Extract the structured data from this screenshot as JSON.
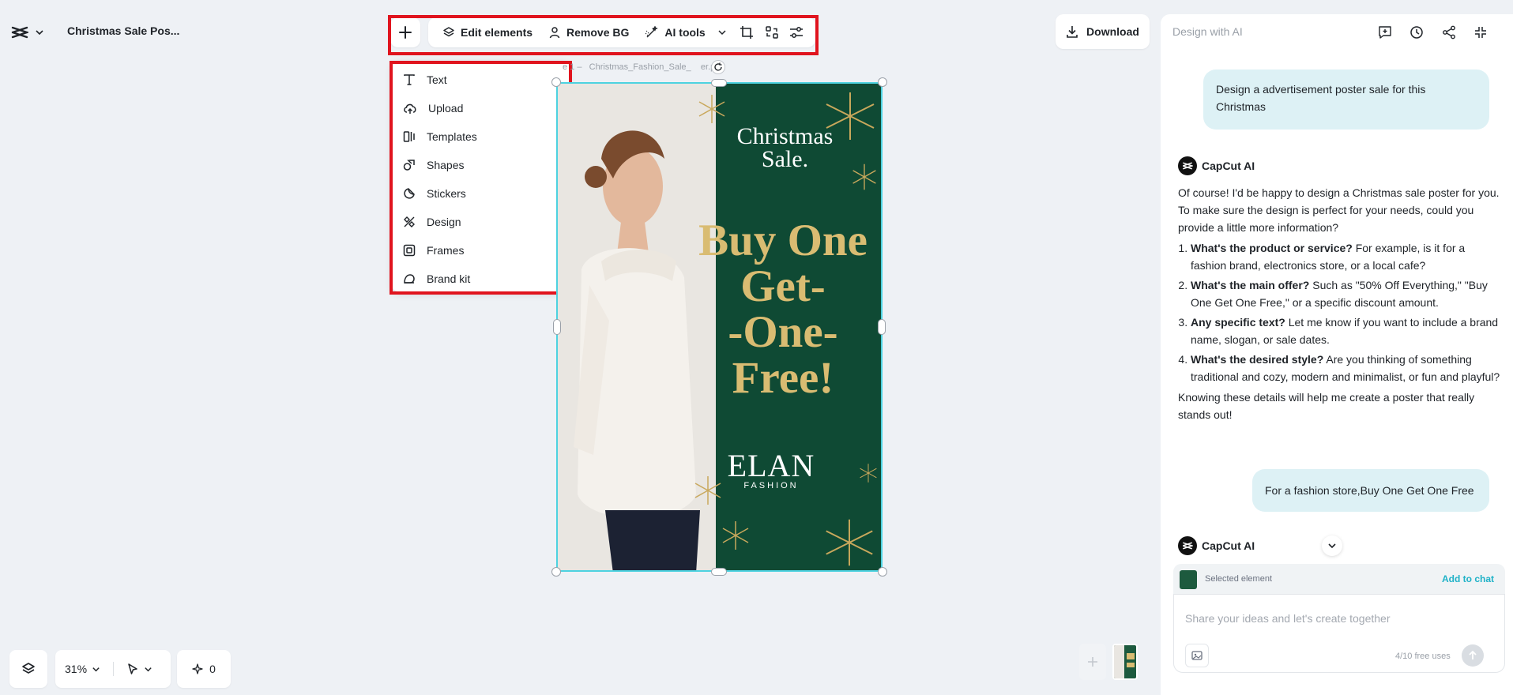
{
  "header": {
    "title": "Christmas Sale Pos..."
  },
  "toolbar": {
    "edit_elements": "Edit elements",
    "remove_bg": "Remove BG",
    "ai_tools": "AI tools"
  },
  "add_menu": {
    "items": [
      {
        "label": "Text",
        "icon": "text-icon"
      },
      {
        "label": "Upload",
        "icon": "cloud-upload-icon"
      },
      {
        "label": "Templates",
        "icon": "templates-icon"
      },
      {
        "label": "Shapes",
        "icon": "shapes-icon"
      },
      {
        "label": "Stickers",
        "icon": "sticker-icon"
      },
      {
        "label": "Design",
        "icon": "design-icon"
      },
      {
        "label": "Frames",
        "icon": "frame-icon"
      },
      {
        "label": "Brand kit",
        "icon": "brand-kit-icon"
      }
    ]
  },
  "canvas": {
    "page_label_a": "e 1 –",
    "page_label_b": "Christmas_Fashion_Sale_",
    "page_label_c": "er.png"
  },
  "poster": {
    "headline_1": "Christmas",
    "headline_2": "Sale.",
    "offer_1": "Buy One",
    "offer_2": "Get-",
    "offer_3": "-One-",
    "offer_4": "Free!",
    "brand": "ELAN",
    "brand_sub": "FASHION"
  },
  "download_label": "Download",
  "panel": {
    "title": "Design with AI",
    "user_msg_1": "Design a advertisement poster sale for this Christmas",
    "ai_name": "CapCut AI",
    "ai_intro": "Of course! I'd be happy to design a Christmas sale poster for you. To make sure the design is perfect for your needs, could you provide a little more information?",
    "ai_q1_bold": "What's the product or service?",
    "ai_q1_rest": " For example, is it for a fashion brand, electronics store, or a local cafe?",
    "ai_q2_bold": "What's the main offer?",
    "ai_q2_rest": " Such as \"50% Off Everything,\" \"Buy One Get One Free,\" or a specific discount amount.",
    "ai_q3_bold": "Any specific text?",
    "ai_q3_rest": " Let me know if you want to include a brand name, slogan, or sale dates.",
    "ai_q4_bold": "What's the desired style?",
    "ai_q4_rest": " Are you thinking of something traditional and cozy, modern and minimalist, or fun and playful?",
    "ai_outro": "Knowing these details will help me create a poster that really stands out!",
    "user_msg_2": "For a fashion store,Buy One Get One Free",
    "ai_name_2": "CapCut AI",
    "selected_label": "Selected element",
    "add_to_chat": "Add to chat",
    "input_placeholder": "Share your ideas and let's create together",
    "free_uses": "4/10 free uses"
  },
  "bottom": {
    "zoom": "31%",
    "counter": "0"
  },
  "colors": {
    "highlight": "#e0141e",
    "poster_bg": "#0f4a34",
    "poster_gold": "#d9bc72",
    "accent": "#1fb2c8"
  }
}
